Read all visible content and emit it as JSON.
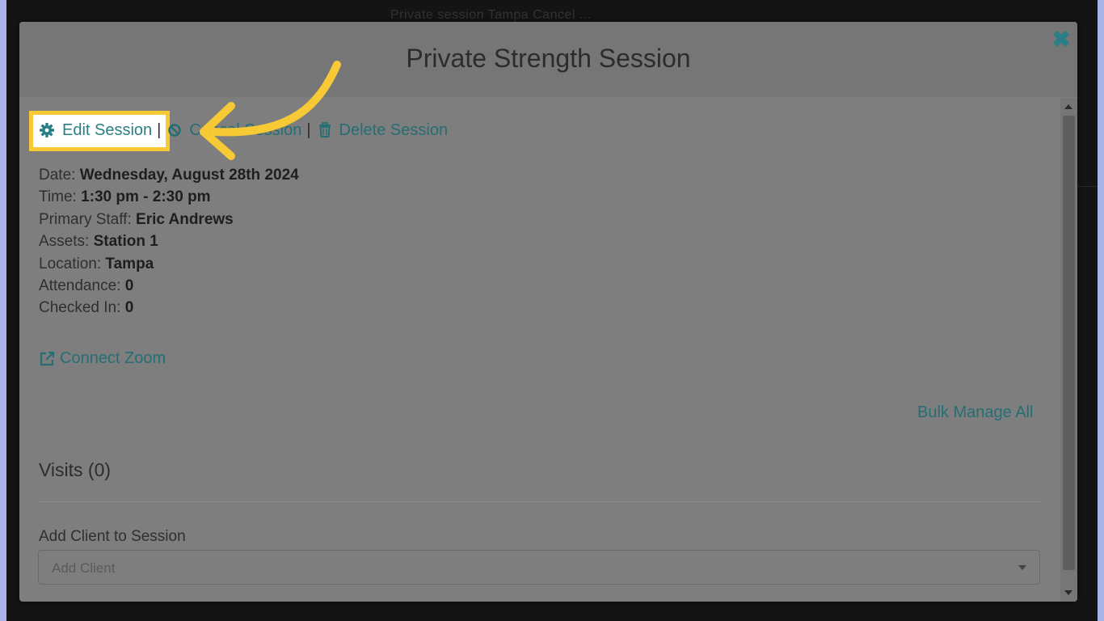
{
  "background": {
    "text": "Private session Tampa Cancel ..."
  },
  "modal": {
    "title": "Private Strength Session",
    "close_icon": "close-icon"
  },
  "actions": {
    "edit_label": "Edit Session",
    "cancel_label": "Cancel Session",
    "delete_label": "Delete Session",
    "separator": "|"
  },
  "details": {
    "date_label": "Date:",
    "date_value": "Wednesday, August 28th 2024",
    "time_label": "Time:",
    "time_value": "1:30 pm - 2:30 pm",
    "staff_label": "Primary Staff:",
    "staff_value": "Eric Andrews",
    "assets_label": "Assets:",
    "assets_value": "Station 1",
    "location_label": "Location:",
    "location_value": "Tampa",
    "attendance_label": "Attendance:",
    "attendance_value": "0",
    "checked_label": "Checked In:",
    "checked_value": "0"
  },
  "links": {
    "zoom": "Connect Zoom",
    "bulk": "Bulk Manage All"
  },
  "visits": {
    "heading": "Visits (0)"
  },
  "add_client": {
    "label": "Add Client to Session",
    "placeholder": "Add Client"
  },
  "colors": {
    "accent": "#2a7f86",
    "highlight": "#f7c935",
    "overlay": "#7e7e7e"
  }
}
